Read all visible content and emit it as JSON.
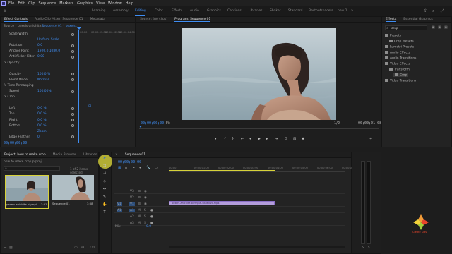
{
  "menu": [
    "File",
    "Edit",
    "Clip",
    "Sequence",
    "Markers",
    "Graphics",
    "View",
    "Window",
    "Help"
  ],
  "workspaces": [
    {
      "label": "Learning",
      "active": false
    },
    {
      "label": "Assembly",
      "active": false
    },
    {
      "label": "Editing",
      "active": true
    },
    {
      "label": "Color",
      "active": false
    },
    {
      "label": "Effects",
      "active": false
    },
    {
      "label": "Audio",
      "active": false
    },
    {
      "label": "Graphics",
      "active": false
    },
    {
      "label": "Captions",
      "active": false
    },
    {
      "label": "Libraries",
      "active": false
    },
    {
      "label": "Shaker",
      "active": false
    },
    {
      "label": "Standard",
      "active": false
    },
    {
      "label": "Besthotspacets",
      "active": false
    },
    {
      "label": "new 1",
      "active": false
    }
  ],
  "effect_controls": {
    "tabs": [
      "Effect Controls",
      "Audio Clip Mixer: Sequence 01",
      "Metadata"
    ],
    "source_line": "Source * pexels-anichite...",
    "sequence_line": "Sequence 01 * pexels...",
    "ruler_times": [
      "00:00",
      "00:00:01:00",
      "00:00:02:00",
      "00:00:04:00"
    ],
    "rows": [
      {
        "label": "Scale Width",
        "value": ""
      },
      {
        "label": "",
        "value": "Uniform Scale"
      },
      {
        "label": "Rotation",
        "value": "0.0"
      },
      {
        "label": "Anchor Point",
        "value": "1920.0  1080.0"
      },
      {
        "label": "Anti-flicker Filter",
        "value": "0.00"
      },
      {
        "label": "fx Opacity",
        "value": ""
      },
      {
        "label": "",
        "value": ""
      },
      {
        "label": "Opacity",
        "value": "100.0 %"
      },
      {
        "label": "Blend Mode",
        "value": "Normal"
      },
      {
        "label": "fx Time Remapping",
        "value": ""
      },
      {
        "label": "Speed",
        "value": "100.00%"
      },
      {
        "label": "fx Crop",
        "value": ""
      },
      {
        "label": "",
        "value": ""
      },
      {
        "label": "Left",
        "value": "0.0 %"
      },
      {
        "label": "Top",
        "value": "0.0 %"
      },
      {
        "label": "Right",
        "value": "0.0 %"
      },
      {
        "label": "Bottom",
        "value": "0.0 %"
      },
      {
        "label": "",
        "value": "Zoom"
      },
      {
        "label": "Edge Feather",
        "value": "0"
      }
    ],
    "timecode": "00;00;00;00"
  },
  "source_monitor": {
    "tab": "Source: (no clips)"
  },
  "program_monitor": {
    "tab": "Program: Sequence 01",
    "timecode_left": "00;00;00;00",
    "fit": "Fit",
    "quality": "1/2",
    "timecode_right": "00;00;01;08"
  },
  "effects_panel": {
    "tabs": [
      "Effects",
      "Essential Graphics"
    ],
    "search_value": "crop",
    "tree": [
      {
        "label": "Presets",
        "indent": 0
      },
      {
        "label": "Crop Presets",
        "indent": 1
      },
      {
        "label": "Lumetri Presets",
        "indent": 0
      },
      {
        "label": "Audio Effects",
        "indent": 0
      },
      {
        "label": "Audio Transitions",
        "indent": 0
      },
      {
        "label": "Video Effects",
        "indent": 0
      },
      {
        "label": "Transform",
        "indent": 1
      },
      {
        "label": "Crop",
        "indent": 2
      },
      {
        "label": "Video Transitions",
        "indent": 0
      }
    ]
  },
  "project_panel": {
    "tabs": [
      "Project: how to make crop",
      "Media Browser",
      "Libraries"
    ],
    "project_file": "how to make crop.prproj",
    "items_selected": "1 of 2 items selected",
    "items": [
      {
        "name": "pexels-anichite-olympia-m...",
        "duration": "3:21"
      },
      {
        "name": "Sequence 01",
        "duration": "3;08"
      }
    ]
  },
  "timeline": {
    "tab": "Sequence 01",
    "timecode": "00;00;00;00",
    "ruler": [
      "00;00",
      "00;00;01;00",
      "00;00;02;00",
      "00;00;03;00",
      "00;00;04;00",
      "00;00;05;00",
      "00;00;06;00",
      "00;00;07;00"
    ],
    "video_tracks": [
      "V3",
      "V2",
      "V1"
    ],
    "audio_tracks": [
      "A1",
      "A2",
      "A3"
    ],
    "master_label": "Mix",
    "master_value": "0.0",
    "clip_label": "pexels-anichite-olympia-5886016.mp4"
  },
  "watermark": {
    "text": "Create Kids",
    "colors": [
      "#f29c38",
      "#e8452c",
      "#a3cf3b",
      "#f2d23a"
    ]
  },
  "colors": {
    "accent": "#3f8df2",
    "clip": "#b39ddb",
    "selection_tool": "#d7d23a"
  }
}
